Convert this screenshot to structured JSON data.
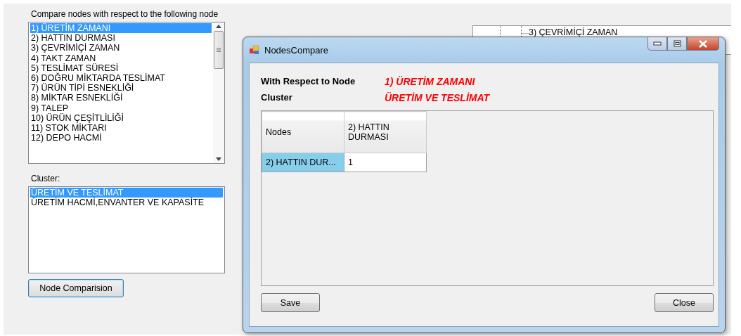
{
  "main_form": {
    "node_label": "Compare nodes with respect to the following node",
    "nodes": [
      {
        "label": "1) ÜRETİM ZAMANI",
        "selected": true
      },
      {
        "label": "2) HATTIN DURMASI",
        "selected": false
      },
      {
        "label": "3) ÇEVRİMİÇİ ZAMAN",
        "selected": false
      },
      {
        "label": "4) TAKT ZAMAN",
        "selected": false
      },
      {
        "label": "5) TESLİMAT SÜRESİ",
        "selected": false
      },
      {
        "label": "6) DOĞRU MİKTARDA TESLİMAT",
        "selected": false
      },
      {
        "label": "7) ÜRÜN TİPİ ESNEKLİĞİ",
        "selected": false
      },
      {
        "label": "8) MİKTAR ESNEKLİĞİ",
        "selected": false
      },
      {
        "label": "9) TALEP",
        "selected": false
      },
      {
        "label": "10) ÜRÜN ÇEŞİTLİLİĞİ",
        "selected": false
      },
      {
        "label": "11) STOK MİKTARI",
        "selected": false
      },
      {
        "label": "12) DEPO HACMİ",
        "selected": false
      }
    ],
    "cluster_label": "Cluster:",
    "clusters": [
      {
        "label": "ÜRETİM VE TESLİMAT",
        "selected": true
      },
      {
        "label": "ÜRETİM HACMİ,ENVANTER VE KAPASİTE",
        "selected": false
      }
    ],
    "compare_button": "Node Comparision",
    "tree": {
      "visible_item": "3) ÇEVRİMİÇİ ZAMAN"
    }
  },
  "dialog": {
    "title": "NodesCompare",
    "fields": [
      {
        "label": "With Respect to Node",
        "value": "1) ÜRETİM ZAMANI"
      },
      {
        "label": "Cluster",
        "value": "ÜRETİM VE TESLİMAT"
      }
    ],
    "table": {
      "columns": [
        "Nodes",
        "2) HATTIN DURMASI"
      ],
      "rows": [
        {
          "selected": true,
          "cells": [
            "2) HATTIN DUR...",
            "1"
          ]
        }
      ]
    },
    "buttons": [
      "Save",
      "Close"
    ]
  }
}
